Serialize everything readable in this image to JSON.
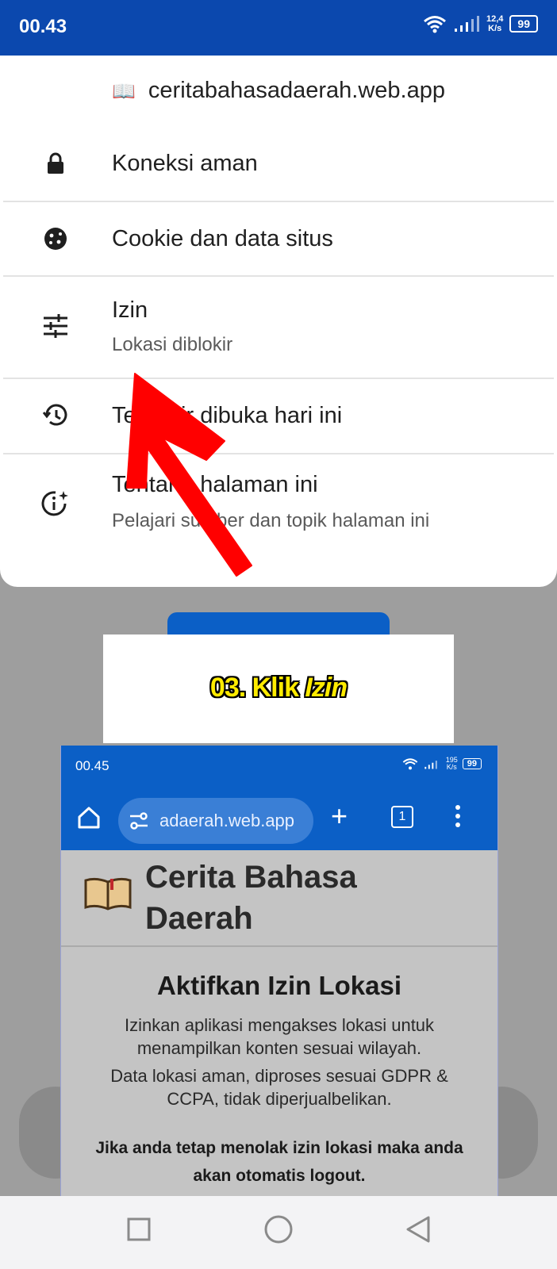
{
  "status_bar": {
    "time": "00.43",
    "speed": "12,4",
    "speed_unit": "K/s",
    "battery": "99"
  },
  "sheet": {
    "url": "ceritabahasadaerah.web.app",
    "items": [
      {
        "icon": "lock-icon",
        "title": "Koneksi aman"
      },
      {
        "icon": "cookie-icon",
        "title": "Cookie dan data situs"
      },
      {
        "icon": "tune-icon",
        "title": "Izin",
        "subtitle": "Lokasi diblokir"
      },
      {
        "icon": "history-icon",
        "title": "Terakhir dibuka hari ini"
      },
      {
        "icon": "info-sparkle-icon",
        "title": "Tentang halaman ini",
        "subtitle": "Pelajari sumber dan topik halaman ini"
      }
    ]
  },
  "caption": {
    "prefix": "03. Klik ",
    "emphasis": "Izin"
  },
  "inner": {
    "time": "00.45",
    "speed": "195",
    "speed_unit": "K/s",
    "battery": "99",
    "url": "adaerah.web.app",
    "tab_count": "1",
    "site_title": "Cerita Bahasa Daerah",
    "heading": "Aktifkan Izin Lokasi",
    "paragraph1": "Izinkan aplikasi mengakses lokasi untuk menampilkan konten sesuai wilayah.",
    "paragraph2": "Data lokasi aman, diproses sesuai GDPR & CCPA, tidak diperjualbelikan.",
    "warning": "Jika anda tetap menolak izin lokasi maka anda akan otomatis logout."
  },
  "colors": {
    "status_blue": "#0b48ae",
    "arrow_red": "#ff0000",
    "caption_yellow": "#ffeb00"
  }
}
